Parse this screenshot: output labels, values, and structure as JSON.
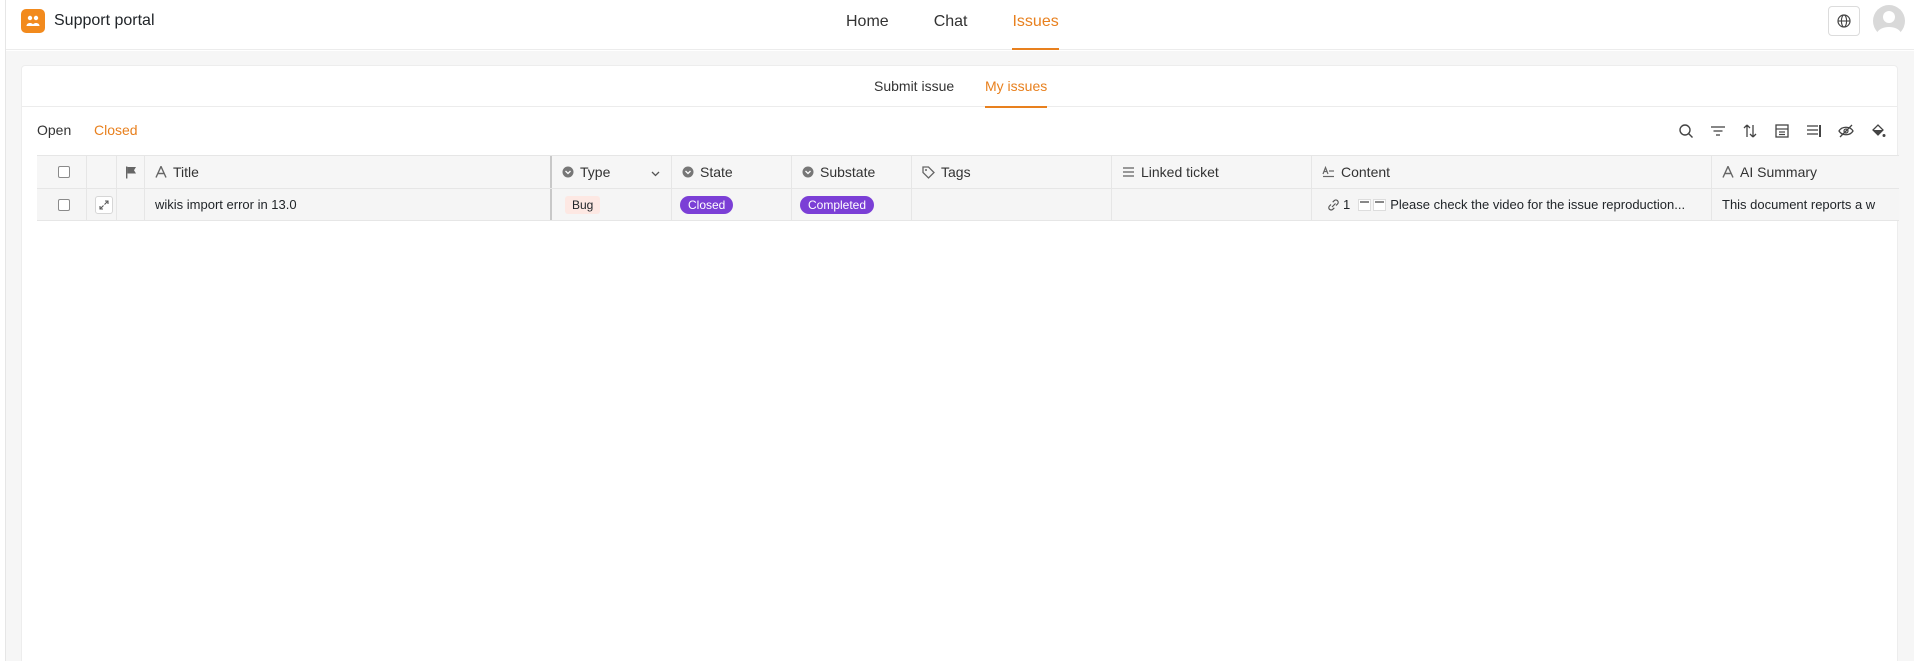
{
  "app": {
    "title": "Support portal",
    "accent_color": "#e8801e"
  },
  "topnav": {
    "items": [
      {
        "label": "Home",
        "active": false
      },
      {
        "label": "Chat",
        "active": false
      },
      {
        "label": "Issues",
        "active": true
      }
    ]
  },
  "subnav": {
    "submit_label": "Submit issue",
    "my_issues_label": "My issues",
    "active": "My issues"
  },
  "filter_tabs": {
    "open_label": "Open",
    "closed_label": "Closed",
    "active": "Closed"
  },
  "toolbar": {
    "icons": [
      "search-icon",
      "filter-icon",
      "sort-icon",
      "group-icon",
      "row-height-icon",
      "hide-columns-icon",
      "paint-bucket-icon"
    ]
  },
  "table": {
    "columns": {
      "title": "Title",
      "type": "Type",
      "state": "State",
      "substate": "Substate",
      "tags": "Tags",
      "linked_ticket": "Linked ticket",
      "content": "Content",
      "ai_summary": "AI Summary"
    },
    "rows": [
      {
        "title": "wikis import error in 13.0",
        "type": "Bug",
        "state": "Closed",
        "substate": "Completed",
        "tags": "",
        "linked_ticket": "",
        "content_attachments": "1",
        "content": "Please check the video for the issue reproduction...",
        "ai_summary": "This document reports a w"
      }
    ]
  },
  "colors": {
    "state_pill": "#7b3fd6",
    "bug_pill": "#fde8e3",
    "logo": "#f28a1d"
  }
}
